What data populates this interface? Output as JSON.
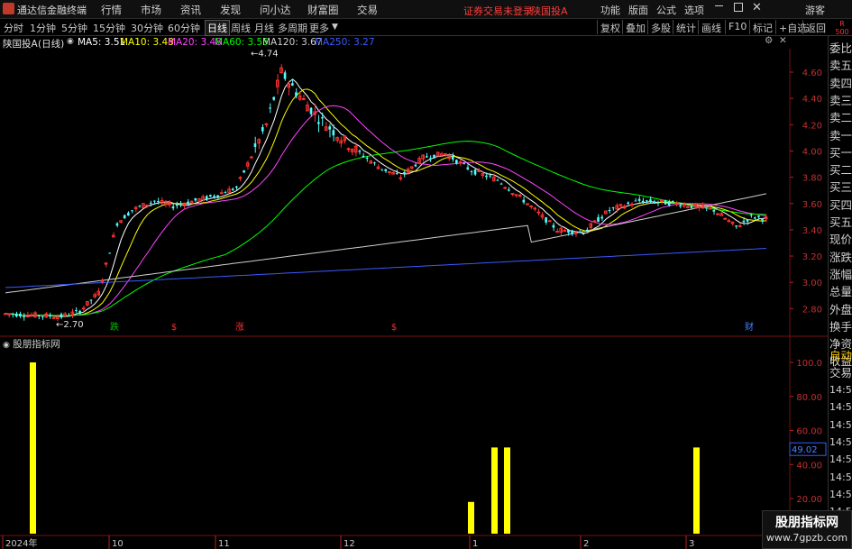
{
  "titlebar": {
    "app_title": "通达信金融终端",
    "menus": [
      "行情",
      "市场",
      "资讯",
      "发现",
      "问小达",
      "财富圈",
      "交易"
    ],
    "status": "证券交易未登录",
    "stock": "陕国投A",
    "sys": [
      "功能",
      "版面",
      "公式",
      "选项"
    ],
    "guest": "游客",
    "corner": "R 500"
  },
  "toolbar": {
    "periods": [
      "分时",
      "1分钟",
      "5分钟",
      "15分钟",
      "30分钟",
      "60分钟",
      "日线",
      "周线",
      "月线",
      "多周期",
      "更多"
    ],
    "active_period": "日线",
    "buttons": [
      "复权",
      "叠加",
      "多股",
      "统计",
      "画线",
      "F10",
      "标记",
      "+自选",
      "返回"
    ]
  },
  "info": {
    "name": "陕国投A",
    "period": "(日线)",
    "ma": [
      {
        "label": "MA5: 3.51",
        "color": "#ffffff"
      },
      {
        "label": "MA10: 3.48",
        "color": "#ffff00"
      },
      {
        "label": "MA20: 3.48",
        "color": "#ff44ff"
      },
      {
        "label": "MA60: 3.55",
        "color": "#00ff00"
      },
      {
        "label": "MA120: 3.67",
        "color": "#d0d0d0"
      },
      {
        "label": "MA250: 3.27",
        "color": "#3b5bff"
      }
    ]
  },
  "chart_data": {
    "type": "candlestick",
    "price_axis": [
      "4.60",
      "4.40",
      "4.20",
      "4.00",
      "3.80",
      "3.60",
      "3.40",
      "3.20",
      "3.00",
      "2.80"
    ],
    "high_label": "4.74",
    "low_label": "2.70",
    "markers": [
      {
        "text": "跌",
        "color": "#00c000"
      },
      {
        "text": "$",
        "color": "#ff3030"
      },
      {
        "text": "涨",
        "color": "#ff3030"
      },
      {
        "text": "$",
        "color": "#ff3030"
      },
      {
        "text": "财",
        "color": "#4080ff"
      }
    ],
    "indicator": {
      "name": "股朋指标网",
      "axis": [
        "100.0",
        "80.00",
        "60.00",
        "40.00",
        "20.00"
      ],
      "current_value": "49.02",
      "bars": [
        {
          "x_index": 0,
          "value": 100
        },
        {
          "x_index": 1,
          "value": 18
        },
        {
          "x_index": 2,
          "value": 50
        },
        {
          "x_index": 3,
          "value": 50
        },
        {
          "x_index": 4,
          "value": 50
        }
      ]
    },
    "date_axis": [
      "2024年",
      "10",
      "11",
      "12",
      "1",
      "2",
      "3"
    ]
  },
  "side_panel": {
    "items": [
      "委比",
      "卖五",
      "卖四",
      "卖三",
      "卖二",
      "卖一",
      "买一",
      "买二",
      "买三",
      "买四",
      "买五",
      "现价",
      "涨跌",
      "涨幅",
      "总量",
      "外盘",
      "换手",
      "净资",
      "收益"
    ],
    "auto": "自动",
    "trade": "交易",
    "times": [
      "14:56",
      "14:56",
      "14:56",
      "14:56",
      "14:56",
      "14:56",
      "14:56",
      "14:56"
    ]
  },
  "watermark": {
    "line1": "股朋指标网",
    "line2": "www.7gpzb.com"
  }
}
